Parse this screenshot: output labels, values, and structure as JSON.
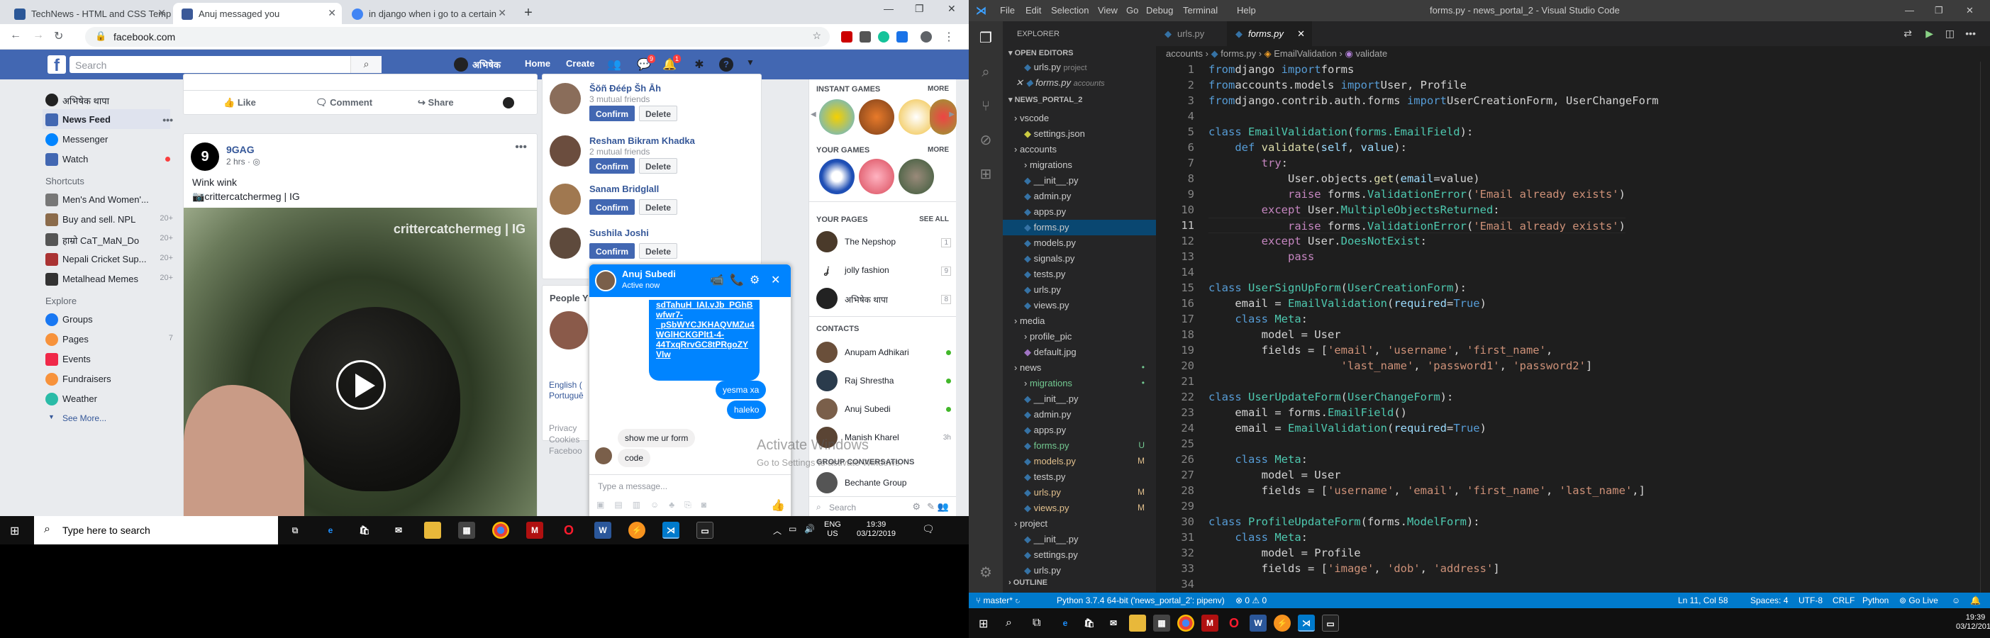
{
  "browser": {
    "tabs": [
      {
        "title": "TechNews - HTML and CSS Temp",
        "color": "#2b5797"
      },
      {
        "title": "Anuj messaged you",
        "color": "#3b5998"
      },
      {
        "title": "in django when i go to a certain",
        "color": "#4285f4"
      }
    ],
    "url": "facebook.com"
  },
  "fb": {
    "search_placeholder": "Search",
    "user": "अभिषेक",
    "home": "Home",
    "create": "Create",
    "badges": {
      "messages": "9",
      "notifications": "1"
    },
    "left": {
      "profile": "अभिषेक थापा",
      "news_feed": "News Feed",
      "messenger": "Messenger",
      "watch": "Watch",
      "shortcuts_header": "Shortcuts",
      "shortcuts": [
        {
          "label": "Men's And Women'...",
          "count": ""
        },
        {
          "label": "Buy and sell. NPL",
          "count": "20+"
        },
        {
          "label": "हाम्रो CaT_MaN_Do",
          "count": "20+"
        },
        {
          "label": "Nepali Cricket Sup...",
          "count": "20+"
        },
        {
          "label": "Metalhead Memes",
          "count": "20+"
        }
      ],
      "explore_header": "Explore",
      "explore": [
        {
          "label": "Groups",
          "count": "",
          "color": "#1877f2"
        },
        {
          "label": "Pages",
          "count": "7",
          "color": "#f7923b"
        },
        {
          "label": "Events",
          "count": "",
          "color": "#f02849"
        },
        {
          "label": "Fundraisers",
          "count": "",
          "color": "#f7923b"
        },
        {
          "label": "Weather",
          "count": "",
          "color": "#2abba7"
        }
      ],
      "see_more": "See More..."
    },
    "post_actions": {
      "like": "Like",
      "comment": "Comment",
      "share": "Share"
    },
    "post": {
      "author": "9GAG",
      "time": "2 hrs · ",
      "text": "Wink wink",
      "credit": "📷crittercatchermeg | IG",
      "watermark": "crittercatchermeg | IG"
    },
    "requests": [
      {
        "name": "Šŏñ Đéép Šh Āh",
        "mutual": "3 mutual friends",
        "color": "#8a6d5a"
      },
      {
        "name": "Resham Bikram Khadka",
        "mutual": "2 mutual friends",
        "color": "#6b4d3e"
      },
      {
        "name": "Sanam Bridglall",
        "mutual": "",
        "color": "#a07850"
      },
      {
        "name": "Sushila Joshi",
        "mutual": "",
        "color": "#5e4a3c"
      }
    ],
    "confirm": "Confirm",
    "delete": "Delete",
    "people": "People Y",
    "lang_snip": "English (",
    "lang_snip2": "Portuguê",
    "privacy_snip": "Privacy",
    "cookies_snip": "Cookies",
    "facebook_snip": "Faceboo",
    "games": {
      "instant": "INSTANT GAMES",
      "more": "MORE",
      "your": "YOUR GAMES",
      "your_pages": "YOUR PAGES",
      "see_all": "SEE ALL",
      "pages": [
        {
          "name": "The Nepshop",
          "count": "1"
        },
        {
          "name": "jolly fashion",
          "count": "9"
        },
        {
          "name": "अभिषेक थापा",
          "count": "8"
        }
      ],
      "contacts": "CONTACTS",
      "contact_list": [
        {
          "name": "Anupam Adhikari",
          "status": "",
          "color": "#6a4f3a"
        },
        {
          "name": "Raj Shrestha",
          "status": "",
          "color": "#2a3b4c"
        },
        {
          "name": "Anuj Subedi",
          "status": "",
          "color": "#7a5f4a"
        },
        {
          "name": "Manish Kharel",
          "status": "3h",
          "color": "#5a4434"
        }
      ],
      "group_conv": "GROUP CONVERSATIONS",
      "group_name": "Bechante Group",
      "search": "Search"
    },
    "chat": {
      "name": "Anuj Subedi",
      "status": "Active now",
      "link_lines": [
        "sdTahuH_IAI.vJb_PGhB",
        "wfwr7-",
        "_pSbWYCJKHAQVMZu4",
        "WGlHCKGPlt1-4-",
        "44TxqRrvGC8tPRgoZY",
        "Vlw"
      ],
      "msgs_me": [
        "yesma xa",
        "haleko"
      ],
      "msgs_them": [
        "show me ur form",
        "code"
      ],
      "input_placeholder": "Type a message...",
      "watermark1": "Activate Windows",
      "watermark2": "Go to Settings to activate Windows."
    }
  },
  "taskbar": {
    "search": "Type here to search",
    "lang1": "ENG",
    "lang2": "US",
    "time": "19:39",
    "date": "03/12/2019"
  },
  "vscode": {
    "title": "forms.py - news_portal_2 - Visual Studio Code",
    "menu": [
      "File",
      "Edit",
      "Selection",
      "View",
      "Go",
      "Debug",
      "Terminal",
      "Help"
    ],
    "explorer": "EXPLORER",
    "open_editors": "OPEN EDITORS",
    "open_files": [
      {
        "name": "urls.py",
        "folder": "project"
      },
      {
        "name": "forms.py",
        "folder": "accounts"
      }
    ],
    "project": "NEWS_PORTAL_2",
    "tree": [
      {
        "name": "vscode",
        "indent": 1,
        "type": "folder",
        "mark": ""
      },
      {
        "name": "settings.json",
        "indent": 2,
        "type": "file",
        "mark": ""
      },
      {
        "name": "accounts",
        "indent": 1,
        "type": "folder",
        "mark": ""
      },
      {
        "name": "migrations",
        "indent": 2,
        "type": "folder",
        "mark": ""
      },
      {
        "name": "__init__.py",
        "indent": 2,
        "type": "file",
        "mark": ""
      },
      {
        "name": "admin.py",
        "indent": 2,
        "type": "file",
        "mark": ""
      },
      {
        "name": "apps.py",
        "indent": 2,
        "type": "file",
        "mark": ""
      },
      {
        "name": "forms.py",
        "indent": 2,
        "type": "file",
        "mark": "",
        "sel": true
      },
      {
        "name": "models.py",
        "indent": 2,
        "type": "file",
        "mark": ""
      },
      {
        "name": "signals.py",
        "indent": 2,
        "type": "file",
        "mark": ""
      },
      {
        "name": "tests.py",
        "indent": 2,
        "type": "file",
        "mark": ""
      },
      {
        "name": "urls.py",
        "indent": 2,
        "type": "file",
        "mark": ""
      },
      {
        "name": "views.py",
        "indent": 2,
        "type": "file",
        "mark": ""
      },
      {
        "name": "media",
        "indent": 1,
        "type": "folder",
        "mark": ""
      },
      {
        "name": "profile_pic",
        "indent": 2,
        "type": "folder",
        "mark": ""
      },
      {
        "name": "default.jpg",
        "indent": 2,
        "type": "file",
        "mark": ""
      },
      {
        "name": "news",
        "indent": 1,
        "type": "folder",
        "mark": "•"
      },
      {
        "name": "migrations",
        "indent": 2,
        "type": "folder",
        "mark": "•",
        "green": true
      },
      {
        "name": "__init__.py",
        "indent": 2,
        "type": "file",
        "mark": ""
      },
      {
        "name": "admin.py",
        "indent": 2,
        "type": "file",
        "mark": ""
      },
      {
        "name": "apps.py",
        "indent": 2,
        "type": "file",
        "mark": ""
      },
      {
        "name": "forms.py",
        "indent": 2,
        "type": "file",
        "mark": "U",
        "green": true
      },
      {
        "name": "models.py",
        "indent": 2,
        "type": "file",
        "mark": "M",
        "yellow": true
      },
      {
        "name": "tests.py",
        "indent": 2,
        "type": "file",
        "mark": ""
      },
      {
        "name": "urls.py",
        "indent": 2,
        "type": "file",
        "mark": "M",
        "yellow": true
      },
      {
        "name": "views.py",
        "indent": 2,
        "type": "file",
        "mark": "M",
        "yellow": true
      },
      {
        "name": "project",
        "indent": 1,
        "type": "folder",
        "mark": ""
      },
      {
        "name": "__init__.py",
        "indent": 2,
        "type": "file",
        "mark": ""
      },
      {
        "name": "settings.py",
        "indent": 2,
        "type": "file",
        "mark": ""
      },
      {
        "name": "urls.py",
        "indent": 2,
        "type": "file",
        "mark": ""
      }
    ],
    "outline": "OUTLINE",
    "tabs": [
      "urls.py",
      "forms.py"
    ],
    "breadcrumb": [
      "accounts",
      "forms.py",
      "EmailValidation",
      "validate"
    ],
    "code": [
      [
        [
          "k",
          "from"
        ],
        [
          "",
          "django "
        ],
        [
          "k",
          "import"
        ],
        [
          "",
          "forms"
        ]
      ],
      [
        [
          "k",
          "from"
        ],
        [
          "",
          "accounts.models "
        ],
        [
          "k",
          "import"
        ],
        [
          "",
          "User, Profile"
        ]
      ],
      [
        [
          "k",
          "from"
        ],
        [
          "",
          "django.contrib.auth.forms "
        ],
        [
          "k",
          "import"
        ],
        [
          "",
          "UserCreationForm, UserChangeForm"
        ]
      ],
      [],
      [
        [
          "k",
          "class "
        ],
        [
          "cls",
          "EmailValidation"
        ],
        [
          "",
          "("
        ],
        [
          "cls",
          "forms.EmailField"
        ],
        [
          "",
          "):"
        ]
      ],
      [
        [
          "",
          "    "
        ],
        [
          "k",
          "def "
        ],
        [
          "fn",
          "validate"
        ],
        [
          "",
          "("
        ],
        [
          "vr",
          "self"
        ],
        [
          "",
          ", "
        ],
        [
          "vr",
          "value"
        ],
        [
          "",
          "):"
        ]
      ],
      [
        [
          "",
          "        "
        ],
        [
          "kw",
          "try"
        ],
        [
          "",
          ":"
        ]
      ],
      [
        [
          "",
          "            User.objects."
        ],
        [
          "fn",
          "get"
        ],
        [
          "",
          "("
        ],
        [
          "vr",
          "email"
        ],
        [
          "",
          "=value)"
        ]
      ],
      [
        [
          "",
          "            "
        ],
        [
          "kw",
          "raise "
        ],
        [
          "",
          "forms."
        ],
        [
          "cls",
          "ValidationError"
        ],
        [
          "",
          "("
        ],
        [
          "st",
          "'Email already exists'"
        ],
        [
          "",
          ")"
        ]
      ],
      [
        [
          "",
          "        "
        ],
        [
          "kw",
          "except "
        ],
        [
          "",
          "User."
        ],
        [
          "cls",
          "MultipleObjectsReturned"
        ],
        [
          "",
          ":"
        ]
      ],
      [
        [
          "",
          "            "
        ],
        [
          "kw",
          "raise "
        ],
        [
          "",
          "forms."
        ],
        [
          "cls",
          "ValidationError"
        ],
        [
          "",
          "("
        ],
        [
          "st",
          "'Email already exists'"
        ],
        [
          "",
          ")"
        ]
      ],
      [
        [
          "",
          "        "
        ],
        [
          "kw",
          "except "
        ],
        [
          "",
          "User."
        ],
        [
          "cls",
          "DoesNotExist"
        ],
        [
          "",
          ":"
        ]
      ],
      [
        [
          "",
          "            "
        ],
        [
          "kw",
          "pass"
        ]
      ],
      [],
      [
        [
          "k",
          "class "
        ],
        [
          "cls",
          "UserSignUpForm"
        ],
        [
          "",
          "("
        ],
        [
          "cls",
          "UserCreationForm"
        ],
        [
          "",
          "):"
        ]
      ],
      [
        [
          "",
          "    email = "
        ],
        [
          "cls",
          "EmailValidation"
        ],
        [
          "",
          "("
        ],
        [
          "vr",
          "required"
        ],
        [
          "",
          "="
        ],
        [
          "k",
          "True"
        ],
        [
          "",
          ")"
        ]
      ],
      [
        [
          "",
          "    "
        ],
        [
          "k",
          "class "
        ],
        [
          "cls",
          "Meta"
        ],
        [
          "",
          ":"
        ]
      ],
      [
        [
          "",
          "        model = User"
        ]
      ],
      [
        [
          "",
          "        fields = ["
        ],
        [
          "st",
          "'email'"
        ],
        [
          "",
          ", "
        ],
        [
          "st",
          "'username'"
        ],
        [
          "",
          ", "
        ],
        [
          "st",
          "'first_name'"
        ],
        [
          "",
          ","
        ]
      ],
      [
        [
          "",
          "                    "
        ],
        [
          "st",
          "'last_name'"
        ],
        [
          "",
          ", "
        ],
        [
          "st",
          "'password1'"
        ],
        [
          "",
          ", "
        ],
        [
          "st",
          "'password2'"
        ],
        [
          "",
          "]"
        ]
      ],
      [],
      [
        [
          "k",
          "class "
        ],
        [
          "cls",
          "UserUpdateForm"
        ],
        [
          "",
          "("
        ],
        [
          "cls",
          "UserChangeForm"
        ],
        [
          "",
          "):"
        ]
      ],
      [
        [
          "",
          "    email = forms."
        ],
        [
          "cls",
          "EmailField"
        ],
        [
          "",
          "()"
        ]
      ],
      [
        [
          "",
          "    email = "
        ],
        [
          "cls",
          "EmailValidation"
        ],
        [
          "",
          "("
        ],
        [
          "vr",
          "required"
        ],
        [
          "",
          "="
        ],
        [
          "k",
          "True"
        ],
        [
          "",
          ")"
        ]
      ],
      [],
      [
        [
          "",
          "    "
        ],
        [
          "k",
          "class "
        ],
        [
          "cls",
          "Meta"
        ],
        [
          "",
          ":"
        ]
      ],
      [
        [
          "",
          "        model = User"
        ]
      ],
      [
        [
          "",
          "        fields = ["
        ],
        [
          "st",
          "'username'"
        ],
        [
          "",
          ", "
        ],
        [
          "st",
          "'email'"
        ],
        [
          "",
          ", "
        ],
        [
          "st",
          "'first_name'"
        ],
        [
          "",
          ", "
        ],
        [
          "st",
          "'last_name'"
        ],
        [
          "",
          ",]"
        ]
      ],
      [],
      [
        [
          "k",
          "class "
        ],
        [
          "cls",
          "ProfileUpdateForm"
        ],
        [
          "",
          "(forms."
        ],
        [
          "cls",
          "ModelForm"
        ],
        [
          "",
          "):"
        ]
      ],
      [
        [
          "",
          "    "
        ],
        [
          "k",
          "class "
        ],
        [
          "cls",
          "Meta"
        ],
        [
          "",
          ":"
        ]
      ],
      [
        [
          "",
          "        model = Profile"
        ]
      ],
      [
        [
          "",
          "        fields = ["
        ],
        [
          "st",
          "'image'"
        ],
        [
          "",
          ", "
        ],
        [
          "st",
          "'dob'"
        ],
        [
          "",
          ", "
        ],
        [
          "st",
          "'address'"
        ],
        [
          "",
          "]"
        ]
      ],
      []
    ],
    "status": {
      "branch": "master*",
      "python": "Python 3.7.4 64-bit ('news_portal_2': pipenv)",
      "problems": "⊗ 0 ⚠ 0",
      "pos": "Ln 11, Col 58",
      "spaces": "Spaces: 4",
      "enc": "UTF-8",
      "eol": "CRLF",
      "lang": "Python",
      "live": "Go Live"
    },
    "clock": {
      "time": "19:39",
      "date": "03/12/2019"
    }
  }
}
